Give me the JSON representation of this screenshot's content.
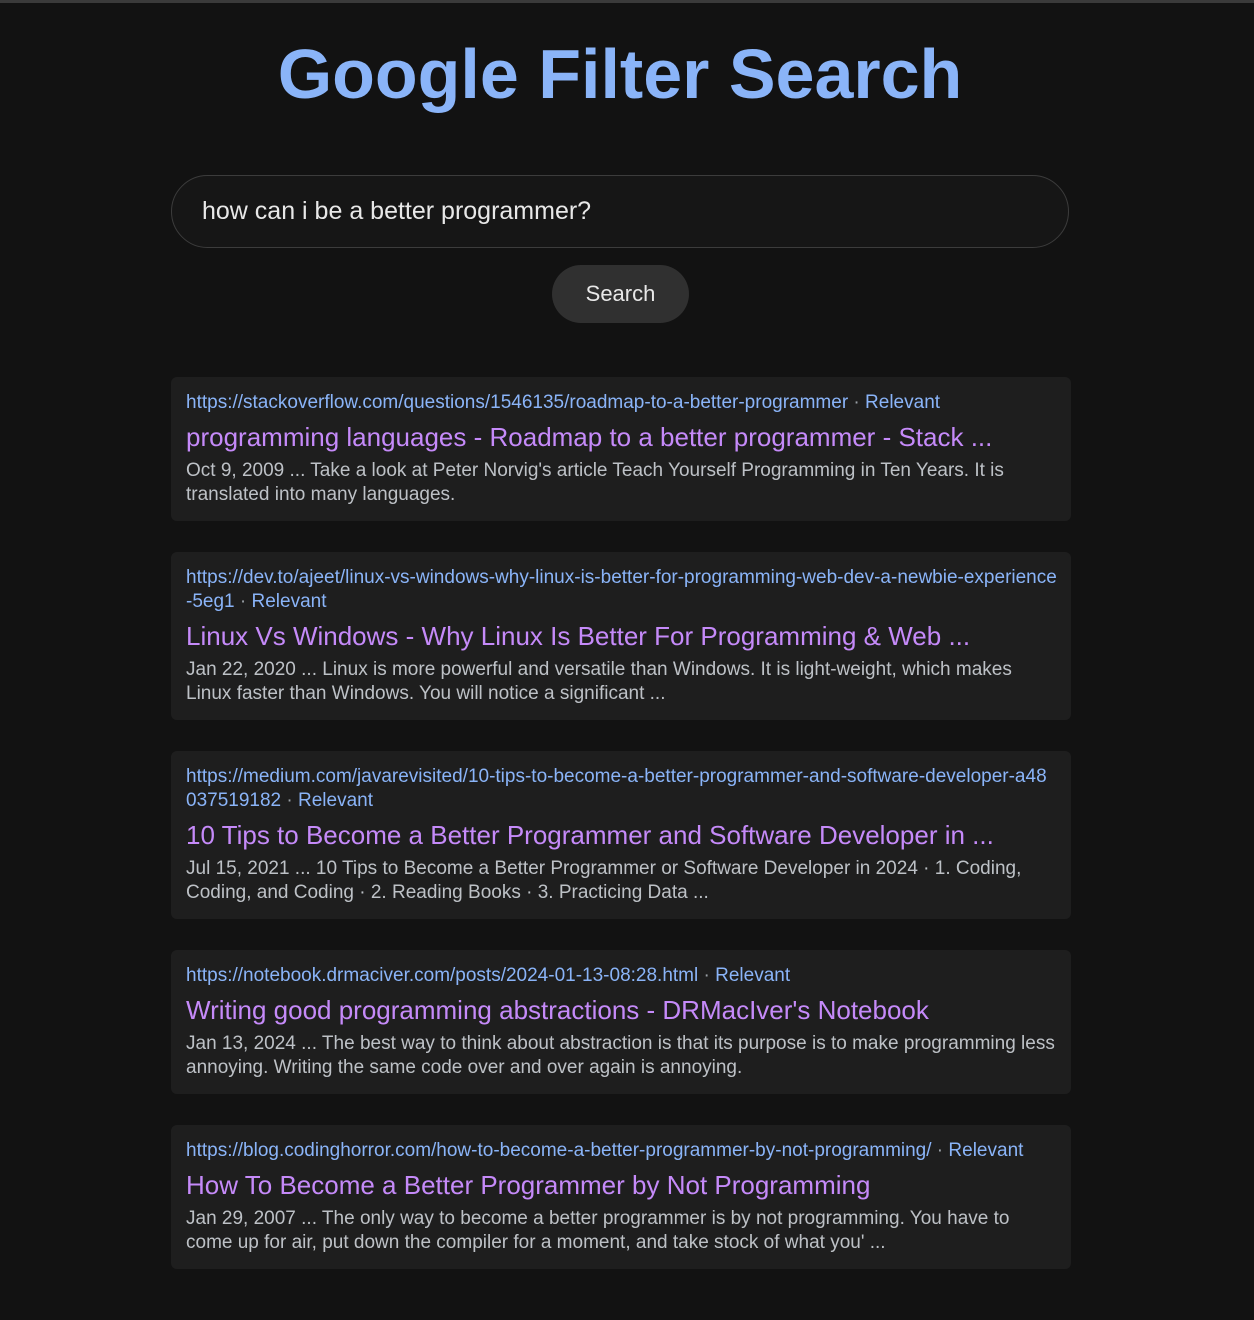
{
  "app": {
    "title": "Google Filter Search"
  },
  "search": {
    "query": "how can i be a better programmer?",
    "button_label": "Search"
  },
  "results": [
    {
      "url": "https://stackoverflow.com/questions/1546135/roadmap-to-a-better-programmer",
      "separator": " · ",
      "tag": "Relevant",
      "title": "programming languages - Roadmap to a better programmer - Stack ...",
      "snippet": "Oct 9, 2009 ... Take a look at Peter Norvig's article Teach Yourself Programming in Ten Years. It is translated into many languages."
    },
    {
      "url": "https://dev.to/ajeet/linux-vs-windows-why-linux-is-better-for-programming-web-dev-a-newbie-experience-5eg1",
      "separator": " · ",
      "tag": "Relevant",
      "title": "Linux Vs Windows - Why Linux Is Better For Programming & Web ...",
      "snippet": "Jan 22, 2020 ... Linux is more powerful and versatile than Windows. It is light-weight, which makes Linux faster than Windows. You will notice a significant ..."
    },
    {
      "url": "https://medium.com/javarevisited/10-tips-to-become-a-better-programmer-and-software-developer-a48037519182",
      "separator": " · ",
      "tag": "Relevant",
      "title": "10 Tips to Become a Better Programmer and Software Developer in ...",
      "snippet": "Jul 15, 2021 ... 10 Tips to Become a Better Programmer or Software Developer in 2024 · 1. Coding, Coding, and Coding · 2. Reading Books · 3. Practicing Data ..."
    },
    {
      "url": "https://notebook.drmaciver.com/posts/2024-01-13-08:28.html",
      "separator": " · ",
      "tag": "Relevant",
      "title": "Writing good programming abstractions - DRMacIver's Notebook",
      "snippet": "Jan 13, 2024 ... The best way to think about abstraction is that its purpose is to make programming less annoying. Writing the same code over and over again is annoying."
    },
    {
      "url": "https://blog.codinghorror.com/how-to-become-a-better-programmer-by-not-programming/",
      "separator": " · ",
      "tag": "Relevant",
      "title": "How To Become a Better Programmer by Not Programming",
      "snippet": "Jan 29, 2007 ... The only way to become a better programmer is by not programming. You have to come up for air, put down the compiler for a moment, and take stock of what you' ..."
    }
  ],
  "colors": {
    "background": "#121212",
    "card": "#1e1e1e",
    "title_accent": "#8ab4f8",
    "result_title": "#c58af9",
    "snippet": "#bdc1c6"
  }
}
